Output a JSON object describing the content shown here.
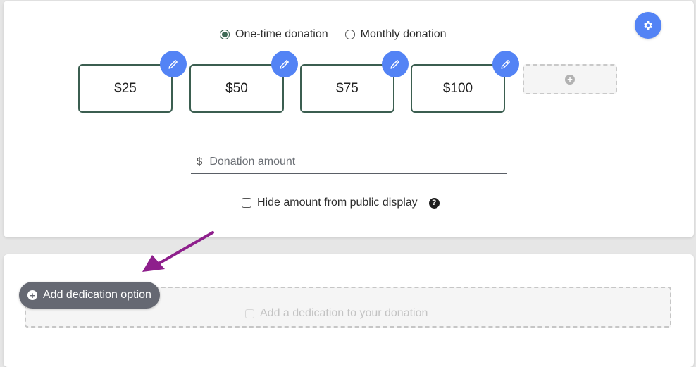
{
  "donation_frequency": {
    "options": [
      {
        "label": "One-time donation",
        "selected": true
      },
      {
        "label": "Monthly donation",
        "selected": false
      }
    ]
  },
  "amounts": [
    {
      "label": "$25"
    },
    {
      "label": "$50"
    },
    {
      "label": "$75"
    },
    {
      "label": "$100"
    }
  ],
  "custom_amount": {
    "currency_symbol": "$",
    "placeholder": "Donation amount",
    "value": ""
  },
  "hide_amount": {
    "label": "Hide amount from public display",
    "checked": false,
    "help_glyph": "?"
  },
  "icons": {
    "settings": "gear-icon",
    "edit": "pencil-icon",
    "add": "plus-circle-icon",
    "help": "question-circle-icon",
    "annotation": "arrow-icon"
  },
  "dedication": {
    "add_button_label": "Add dedication option",
    "checkbox_label": "Add a dedication to your donation",
    "checked": false
  },
  "colors": {
    "accent_blue": "#5383f5",
    "amount_border_green": "#3b5e50",
    "annotation_arrow": "#8e1f8c",
    "tooltip_button": "#656872"
  }
}
